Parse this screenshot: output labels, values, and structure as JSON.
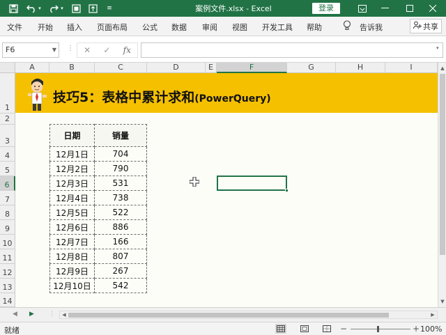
{
  "window": {
    "title": "案例文件.xlsx  -  Excel",
    "login_label": "登录",
    "quick_access_icons": [
      "save-icon",
      "undo-icon",
      "redo-icon",
      "screenshot-icon",
      "fullscreen-icon",
      "customize-icon"
    ],
    "controls": [
      "ribbon-display-icon",
      "minimize-icon",
      "maximize-icon",
      "close-icon"
    ]
  },
  "ribbon": {
    "tabs": [
      "文件",
      "开始",
      "插入",
      "页面布局",
      "公式",
      "数据",
      "审阅",
      "视图",
      "开发工具",
      "帮助"
    ],
    "tell_me": "告诉我",
    "share_label": "共享"
  },
  "formula_bar": {
    "name_box": "F6",
    "formula": "",
    "fx_label": "fx"
  },
  "grid": {
    "columns": [
      "A",
      "B",
      "C",
      "D",
      "E",
      "F",
      "G",
      "H",
      "I"
    ],
    "rows": [
      "1",
      "2",
      "3",
      "4",
      "5",
      "6",
      "7",
      "8",
      "9",
      "10",
      "11",
      "12",
      "13",
      "14"
    ],
    "selected_column": "F",
    "selected_row": "6"
  },
  "banner": {
    "title": "技巧5：表格中累计求和",
    "subtitle": "(PowerQuery)"
  },
  "table": {
    "headers": [
      "日期",
      "销量"
    ],
    "rows": [
      [
        "12月1日",
        "704"
      ],
      [
        "12月2日",
        "790"
      ],
      [
        "12月3日",
        "531"
      ],
      [
        "12月4日",
        "738"
      ],
      [
        "12月5日",
        "522"
      ],
      [
        "12月6日",
        "886"
      ],
      [
        "12月7日",
        "166"
      ],
      [
        "12月8日",
        "807"
      ],
      [
        "12月9日",
        "267"
      ],
      [
        "12月10日",
        "542"
      ]
    ]
  },
  "status_bar": {
    "status": "就绪",
    "zoom": "100%",
    "zoom_minus": "−",
    "zoom_plus": "+"
  },
  "colors": {
    "accent": "#217346",
    "banner": "#f5c000"
  }
}
